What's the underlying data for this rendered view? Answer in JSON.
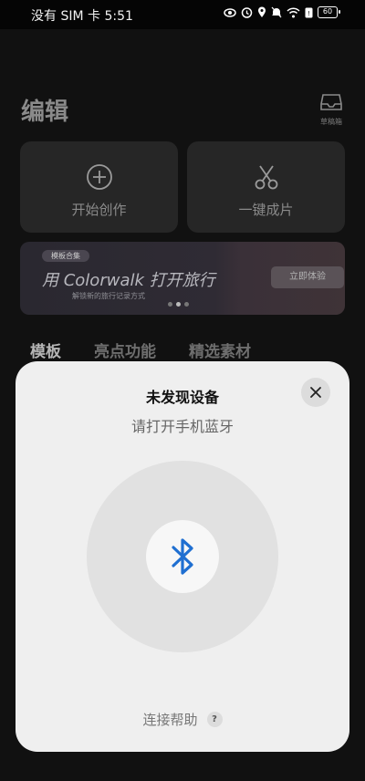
{
  "status_bar": {
    "carrier_time": "没有 SIM 卡 5:51",
    "battery": "60"
  },
  "page": {
    "title": "编辑",
    "drafts_label": "草稿箱",
    "cards": [
      {
        "label": "开始创作",
        "icon": "plus-circle-icon"
      },
      {
        "label": "一键成片",
        "icon": "scissors-icon"
      }
    ],
    "banner": {
      "tag": "模板合集",
      "headline": "用 Colorwalk 打开旅行",
      "subtext": "解锁新的旅行记录方式",
      "cta": "立即体验"
    },
    "tabs": [
      "模板",
      "亮点功能",
      "精选素材"
    ]
  },
  "sheet": {
    "title": "未发现设备",
    "subtitle": "请打开手机蓝牙",
    "help_label": "连接帮助",
    "help_icon": "?",
    "accent_color": "#1f6fd1"
  }
}
